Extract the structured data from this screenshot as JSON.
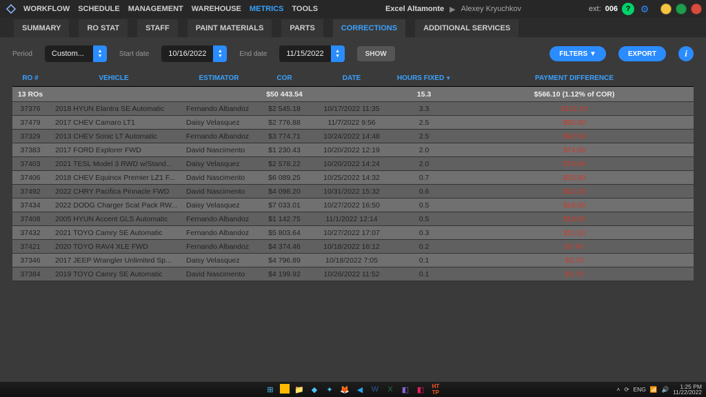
{
  "nav": {
    "items": [
      "WORKFLOW",
      "SCHEDULE",
      "MANAGEMENT",
      "WAREHOUSE",
      "METRICS",
      "TOOLS"
    ],
    "active": 4
  },
  "header": {
    "shop": "Excel Altamonte",
    "user": "Alexey Kryuchkov",
    "ext_label": "ext:",
    "ext_num": "006"
  },
  "subtabs": {
    "items": [
      "SUMMARY",
      "RO STAT",
      "STAFF",
      "PAINT MATERIALS",
      "PARTS",
      "CORRECTIONS",
      "ADDITIONAL SERVICES"
    ],
    "active": 5
  },
  "filters": {
    "period_label": "Period",
    "period_value": "Custom...",
    "start_label": "Start date",
    "start_value": "10/16/2022",
    "end_label": "End date",
    "end_value": "11/15/2022",
    "show": "SHOW",
    "filters_btn": "FILTERS ▼",
    "export_btn": "EXPORT"
  },
  "grid": {
    "headers": {
      "ro": "RO #",
      "vehicle": "VEHICLE",
      "est": "ESTIMATOR",
      "cor": "COR",
      "date": "DATE",
      "hours": "HOURS FIXED",
      "pay": "PAYMENT DIFFERENCE"
    },
    "totals": {
      "ros": "13 ROs",
      "cor": "$50 443.54",
      "hours": "15.3",
      "pay": "$566.10  (1.12% of COR)"
    },
    "rows": [
      {
        "ro": "37376",
        "vehicle": "2018 HYUN Elantra SE Automatic",
        "est": "Fernando Albandoz",
        "cor": "$2 545.18",
        "date": "10/17/2022 11:35",
        "hours": "3.3",
        "pay": "$122.10"
      },
      {
        "ro": "37479",
        "vehicle": "2017 CHEV Camaro LT1",
        "est": "Daisy Velasquez",
        "cor": "$2 776.88",
        "date": "11/7/2022 9:56",
        "hours": "2.5",
        "pay": "$92.50"
      },
      {
        "ro": "37329",
        "vehicle": "2013 CHEV Sonic LT Automatic",
        "est": "Fernando Albandoz",
        "cor": "$3 774.71",
        "date": "10/24/2022 14:48",
        "hours": "2.5",
        "pay": "$92.50"
      },
      {
        "ro": "37383",
        "vehicle": "2017 FORD Explorer FWD",
        "est": "David Nascimento",
        "cor": "$1 230.43",
        "date": "10/20/2022 12:19",
        "hours": "2.0",
        "pay": "$74.00"
      },
      {
        "ro": "37403",
        "vehicle": "2021 TESL Model 3 RWD w/Stand...",
        "est": "Daisy Velasquez",
        "cor": "$2 578.22",
        "date": "10/20/2022 14:24",
        "hours": "2.0",
        "pay": "$74.00"
      },
      {
        "ro": "37406",
        "vehicle": "2018 CHEV Equinox Premier LZ1 F...",
        "est": "David Nascimento",
        "cor": "$6 089.25",
        "date": "10/25/2022 14:32",
        "hours": "0.7",
        "pay": "$25.90"
      },
      {
        "ro": "37492",
        "vehicle": "2022 CHRY Pacifica Pinnacle FWD",
        "est": "David Nascimento",
        "cor": "$4 098.20",
        "date": "10/31/2022 15:32",
        "hours": "0.6",
        "pay": "$22.20"
      },
      {
        "ro": "37434",
        "vehicle": "2022 DODG Charger Scat Pack RW...",
        "est": "Daisy Velasquez",
        "cor": "$7 033.01",
        "date": "10/27/2022 16:50",
        "hours": "0.5",
        "pay": "$18.50"
      },
      {
        "ro": "37408",
        "vehicle": "2005 HYUN Accent GLS Automatic",
        "est": "Fernando Albandoz",
        "cor": "$1 142.75",
        "date": "11/1/2022 12:14",
        "hours": "0.5",
        "pay": "$18.50"
      },
      {
        "ro": "37432",
        "vehicle": "2021 TOYO Camry SE Automatic",
        "est": "Fernando Albandoz",
        "cor": "$5 803.64",
        "date": "10/27/2022 17:07",
        "hours": "0.3",
        "pay": "$11.10"
      },
      {
        "ro": "37421",
        "vehicle": "2020 TOYO RAV4 XLE FWD",
        "est": "Fernando Albandoz",
        "cor": "$4 374.46",
        "date": "10/18/2022 16:12",
        "hours": "0.2",
        "pay": "$7.40"
      },
      {
        "ro": "37346",
        "vehicle": "2017 JEEP Wrangler Unlimited Sp...",
        "est": "Daisy Velasquez",
        "cor": "$4 796.89",
        "date": "10/18/2022 7:05",
        "hours": "0.1",
        "pay": "$3.70"
      },
      {
        "ro": "37384",
        "vehicle": "2019 TOYO Camry SE Automatic",
        "est": "David Nascimento",
        "cor": "$4 199.92",
        "date": "10/26/2022 11:52",
        "hours": "0.1",
        "pay": "$3.70"
      }
    ]
  },
  "tray": {
    "lang": "ENG",
    "time": "1:25 PM",
    "date": "11/22/2022"
  }
}
